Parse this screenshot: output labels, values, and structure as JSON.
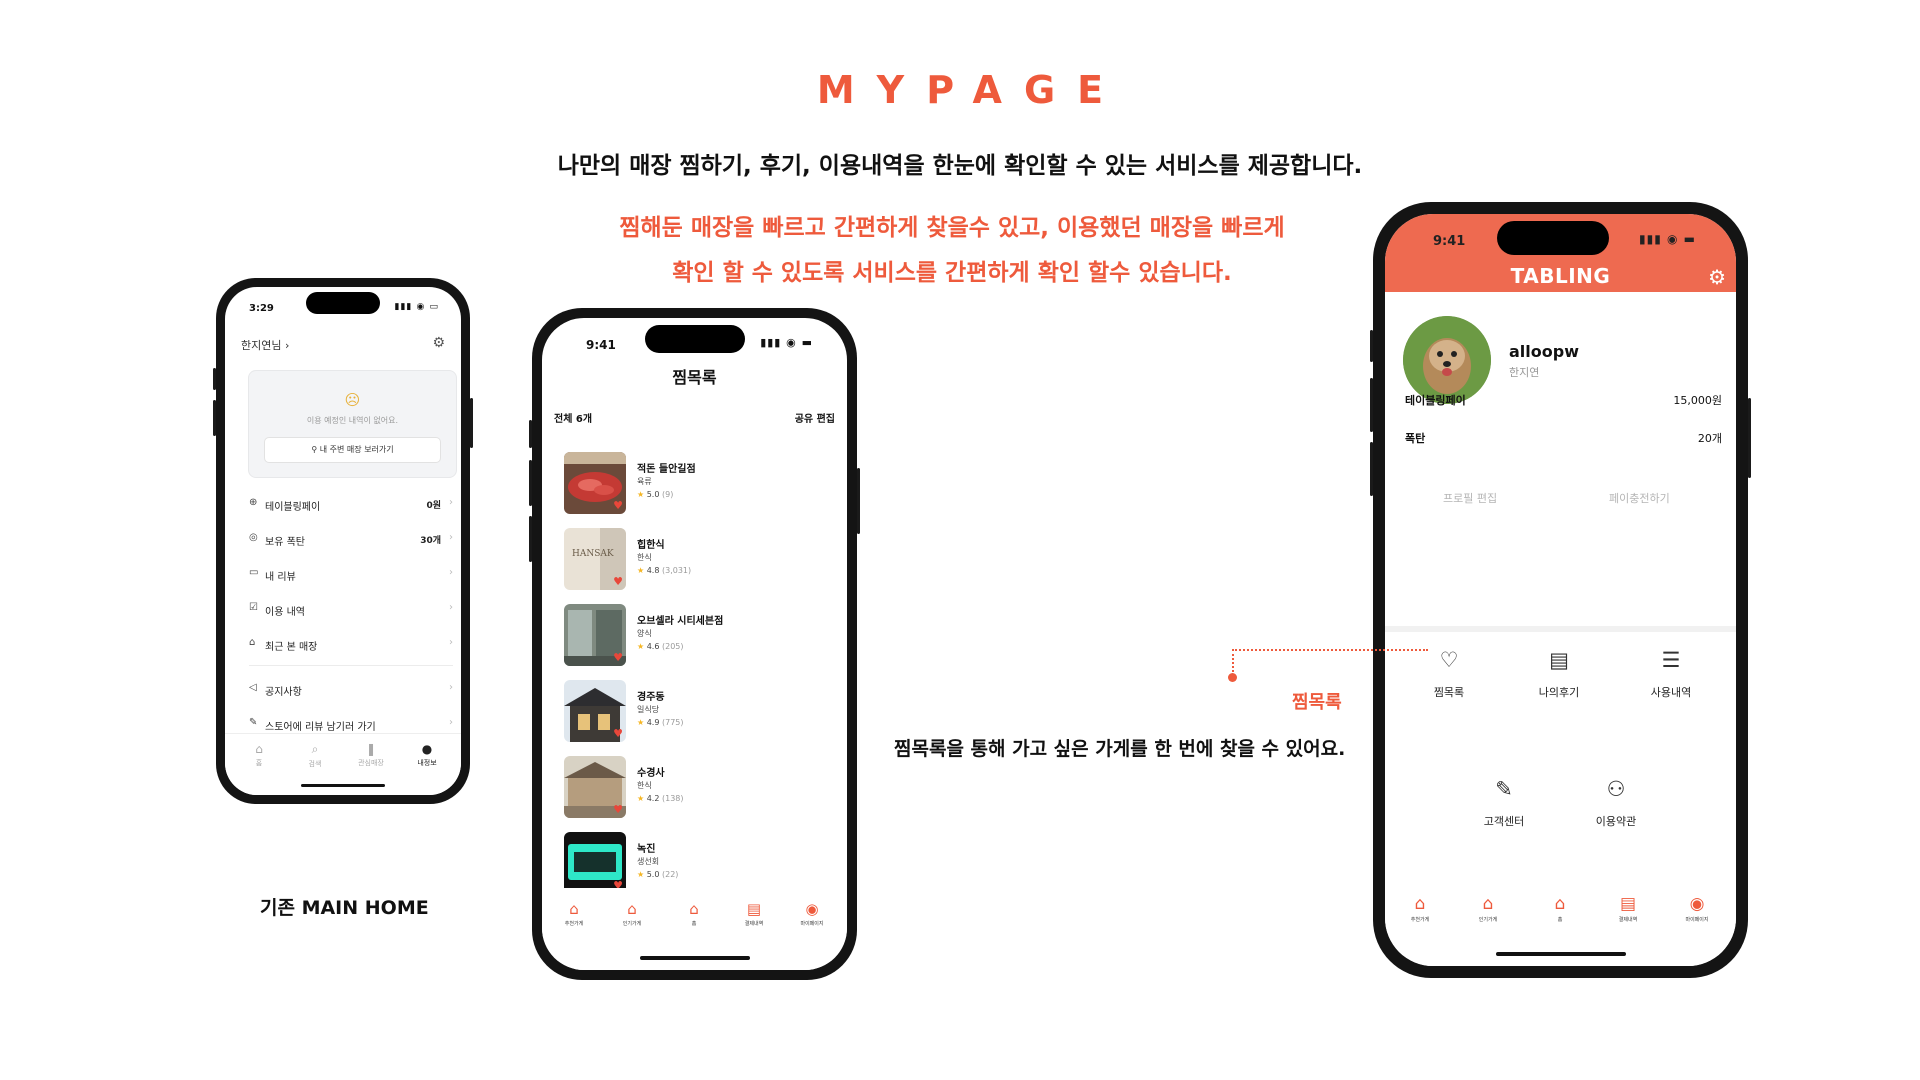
{
  "header": {
    "title": "MYPAGE",
    "subtitle": "나만의 매장 찜하기, 후기, 이용내역을 한눈에 확인할 수 있는 서비스를 제공합니다.",
    "accent_line1": "찜해둔 매장을 빠르고 간편하게 찾을수 있고, 이용했던 매장을 빠르게",
    "accent_line2": "확인 할 수 있도록 서비스를 간편하게 확인 할수 있습니다."
  },
  "old_home": {
    "caption": "기존 MAIN HOME",
    "time": "3:29",
    "status_icons": "▮▮▮ ◉ ▭",
    "user": "한지연님 ›",
    "card": {
      "message": "이용 예정인 내역이 없어요.",
      "button": "⚲ 내 주변 매장 보러가기"
    },
    "rows": [
      {
        "icon": "⊕",
        "label": "테이블링페이",
        "value": "0원"
      },
      {
        "icon": "◎",
        "label": "보유 폭탄",
        "value": "30개"
      },
      {
        "icon": "▭",
        "label": "내 리뷰",
        "value": ""
      },
      {
        "icon": "☑",
        "label": "이용 내역",
        "value": ""
      },
      {
        "icon": "⌂",
        "label": "최근 본 매장",
        "value": ""
      },
      {
        "icon": "◁",
        "label": "공지사항",
        "value": ""
      },
      {
        "icon": "✎",
        "label": "스토어에 리뷰 남기러 가기",
        "value": ""
      }
    ],
    "tabs": [
      {
        "icon": "⌂",
        "label": "홈"
      },
      {
        "icon": "⌕",
        "label": "검색"
      },
      {
        "icon": "❚",
        "label": "관심매장"
      },
      {
        "icon": "●",
        "label": "내정보"
      }
    ]
  },
  "wishlist": {
    "time": "9:41",
    "status_icons": "▮▮▮ ◉ ▬",
    "title": "찜목록",
    "total": "전체 6개",
    "actions": "공유  편집",
    "items": [
      {
        "name": "적돈 들안길점",
        "category": "육류",
        "rating": "5.0",
        "count": "(9)"
      },
      {
        "name": "힙한식",
        "category": "한식",
        "rating": "4.8",
        "count": "(3,031)"
      },
      {
        "name": "오브셀라 시티세븐점",
        "category": "양식",
        "rating": "4.6",
        "count": "(205)"
      },
      {
        "name": "경주동",
        "category": "일식당",
        "rating": "4.9",
        "count": "(775)"
      },
      {
        "name": "수경사",
        "category": "한식",
        "rating": "4.2",
        "count": "(138)"
      },
      {
        "name": "녹진",
        "category": "생선회",
        "rating": "5.0",
        "count": "(22)"
      }
    ],
    "tabs": [
      {
        "icon": "⌂",
        "label": "추천가게"
      },
      {
        "icon": "⌂",
        "label": "인기가게"
      },
      {
        "icon": "⌂",
        "label": "홈"
      },
      {
        "icon": "▤",
        "label": "결제내역"
      },
      {
        "icon": "◉",
        "label": "마이페이지"
      }
    ]
  },
  "mypage": {
    "time": "9:41",
    "status_icons": "▮▮▮ ◉ ▬",
    "brand": "TABLING",
    "username": "alloopw",
    "realname": "한지연",
    "pay_label": "테이블링페이",
    "pay_value": "15,000원",
    "bomb_label": "폭탄",
    "bomb_value": "20개",
    "edit_profile": "프로필 편집",
    "charge_pay": "페이충전하기",
    "menu": [
      {
        "icon": "♡",
        "label": "찜목록"
      },
      {
        "icon": "▤",
        "label": "나의후기"
      },
      {
        "icon": "☰",
        "label": "사용내역"
      },
      {
        "icon": "✎",
        "label": "고객센터"
      },
      {
        "icon": "⚇",
        "label": "이용약관"
      }
    ],
    "tabs": [
      {
        "icon": "⌂",
        "label": "추천가게"
      },
      {
        "icon": "⌂",
        "label": "인기가게"
      },
      {
        "icon": "⌂",
        "label": "홈"
      },
      {
        "icon": "▤",
        "label": "결제내역"
      },
      {
        "icon": "◉",
        "label": "마이페이지"
      }
    ]
  },
  "callout": {
    "title": "찜목록",
    "description": "찜목록을 통해 가고 싶은 가게를 한 번에 찾을 수 있어요."
  },
  "colors": {
    "accent": "#ee5a3c",
    "header_bg": "#ee6a50",
    "star": "#f5b623",
    "heart": "#e8473a"
  }
}
